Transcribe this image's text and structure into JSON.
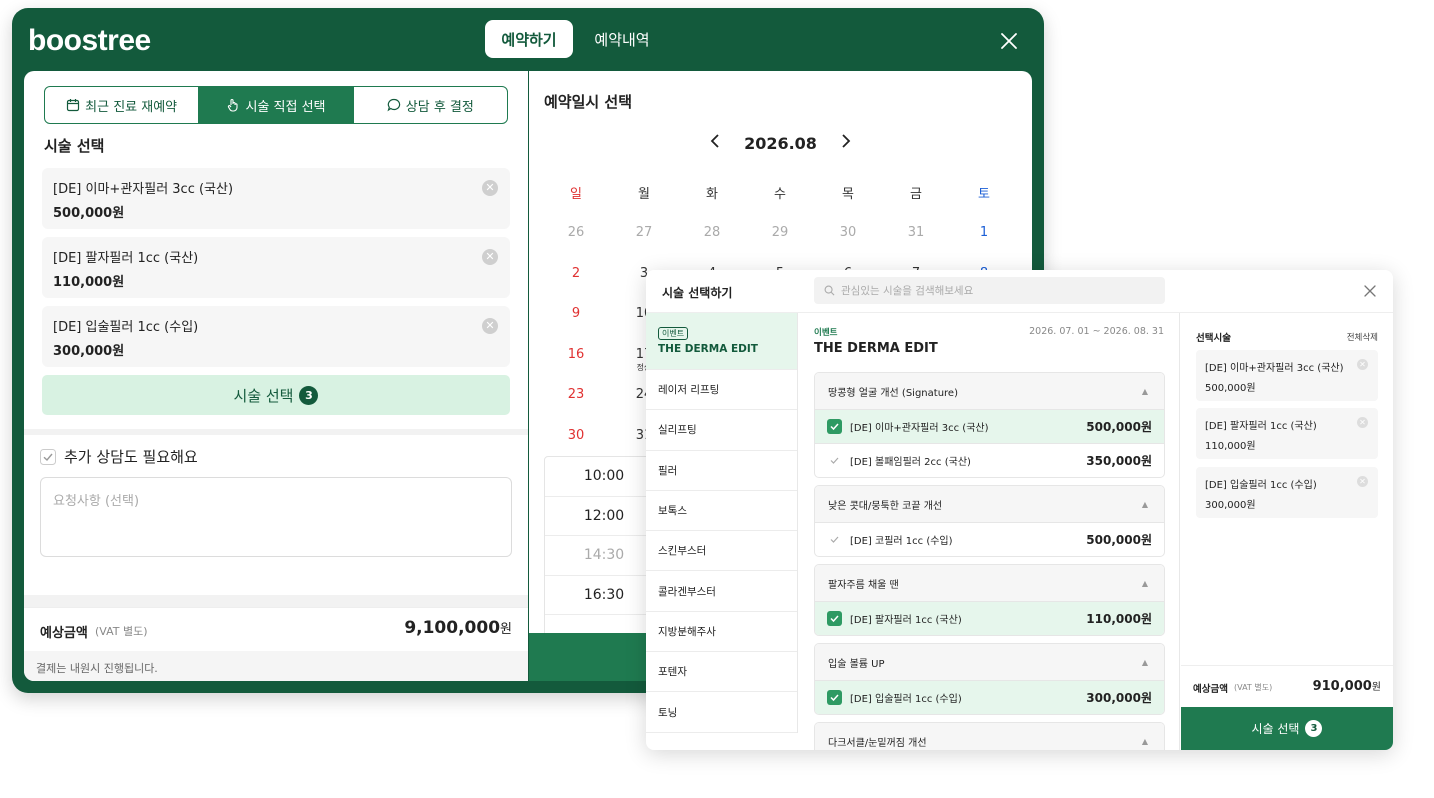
{
  "app": {
    "logo": "boostree",
    "tabs": [
      "예약하기",
      "예약내역"
    ]
  },
  "left": {
    "segments": [
      "최근 진료 재예약",
      "시술 직접 선택",
      "상담 후 결정"
    ],
    "section_title": "시술 선택",
    "selected": [
      {
        "name": "[DE] 이마+관자필러 3cc (국산)",
        "price": "500,000원"
      },
      {
        "name": "[DE] 팔자필러 1cc (국산)",
        "price": "110,000원"
      },
      {
        "name": "[DE] 입술필러 1cc (수입)",
        "price": "300,000원"
      }
    ],
    "select_button": "시술 선택",
    "select_count": "3",
    "consult_label": "추가 상담도 필요해요",
    "request_placeholder": "요청사항 (선택)",
    "total_label": "예상금액",
    "vat_label": "(VAT 별도)",
    "total_value": "9,100,000",
    "total_unit": "원",
    "payment_note": "결제는 내원시 진행됩니다."
  },
  "calendar": {
    "title": "예약일시 선택",
    "month": "2026.08",
    "weekdays": [
      "일",
      "월",
      "화",
      "수",
      "목",
      "금",
      "토"
    ],
    "rows": [
      [
        "26",
        "27",
        "28",
        "29",
        "30",
        "31",
        "1"
      ],
      [
        "2",
        "3",
        "4",
        "5",
        "6",
        "7",
        "8"
      ],
      [
        "9",
        "10",
        "",
        "",
        "",
        "",
        ""
      ],
      [
        "16",
        "17",
        "",
        "",
        "",
        "",
        ""
      ],
      [
        "23",
        "24",
        "",
        "",
        "",
        "",
        ""
      ],
      [
        "30",
        "31",
        "",
        "",
        "",
        "",
        ""
      ]
    ],
    "note17": "정상",
    "times": [
      "10:00",
      "12:00",
      "14:30",
      "16:30"
    ]
  },
  "modal": {
    "title": "시술 선택하기",
    "search_placeholder": "관심있는 시술을 검색해보세요",
    "categories": [
      "레이저 리프팅",
      "실리프팅",
      "필러",
      "보톡스",
      "스킨부스터",
      "콜라겐부스터",
      "지방분해주사",
      "포텐자",
      "토닝"
    ],
    "event_tag": "이벤트",
    "event_category": "THE DERMA EDIT",
    "event_label": "이벤트",
    "event_date": "2026. 07. 01 ~ 2026. 08. 31",
    "event_title": "THE DERMA EDIT",
    "groups": [
      {
        "title": "땅콩형 얼굴 개선 (Signature)",
        "items": [
          {
            "name": "[DE] 이마+관자필러 3cc (국산)",
            "price": "500,000원",
            "checked": true
          },
          {
            "name": "[DE] 볼패임필러 2cc (국산)",
            "price": "350,000원",
            "checked": false
          }
        ]
      },
      {
        "title": "낮은 콧대/뭉툭한 코끝 개선",
        "items": [
          {
            "name": "[DE] 코필러 1cc (수입)",
            "price": "500,000원",
            "checked": false
          }
        ]
      },
      {
        "title": "팔자주름 채울 땐",
        "items": [
          {
            "name": "[DE] 팔자필러 1cc (국산)",
            "price": "110,000원",
            "checked": true
          }
        ]
      },
      {
        "title": "입술 볼륨 UP",
        "items": [
          {
            "name": "[DE] 입술필러 1cc (수입)",
            "price": "300,000원",
            "checked": true
          }
        ]
      },
      {
        "title": "다크서클/눈밑꺼짐 개선",
        "items": []
      }
    ],
    "selected_title": "선택시술",
    "delete_all": "전체삭제",
    "selected": [
      {
        "name": "[DE] 이마+관자필러 3cc (국산)",
        "price": "500,000원"
      },
      {
        "name": "[DE] 팔자필러 1cc (국산)",
        "price": "110,000원"
      },
      {
        "name": "[DE] 입술필러 1cc (수입)",
        "price": "300,000원"
      }
    ],
    "total_label": "예상금액",
    "vat_label": "(VAT 별도)",
    "total_value": "910,000",
    "total_unit": "원",
    "button": "시술 선택",
    "count": "3"
  },
  "colors": {
    "brand": "#135a3c",
    "accent": "#1f7a50",
    "light": "#d8f2e2",
    "sunday": "#e03131",
    "saturday": "#1c5fd6"
  }
}
